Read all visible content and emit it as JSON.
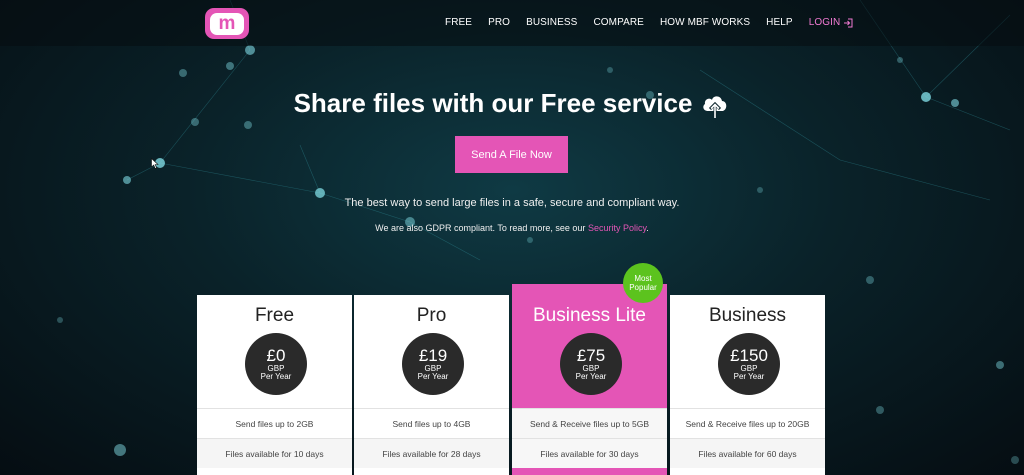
{
  "nav": {
    "items": [
      "FREE",
      "PRO",
      "BUSINESS",
      "COMPARE",
      "HOW MBF WORKS",
      "HELP"
    ],
    "login": "LOGIN"
  },
  "logo": {
    "letter": "m"
  },
  "hero": {
    "title": "Share files with our Free service",
    "cta": "Send A File Now",
    "tagline": "The best way to send large files in a safe, secure and compliant way.",
    "gdpr_prefix": "We are also GDPR compliant. To read more, see our ",
    "gdpr_link": "Security Policy",
    "gdpr_suffix": "."
  },
  "badge": {
    "line1": "Most",
    "line2": "Popular"
  },
  "plans": [
    {
      "name": "Free",
      "amount": "£0",
      "currency": "GBP",
      "period": "Per Year",
      "features": [
        "Send files up to 2GB",
        "Files available for 10 days"
      ]
    },
    {
      "name": "Pro",
      "amount": "£19",
      "currency": "GBP",
      "period": "Per Year",
      "features": [
        "Send files up to 4GB",
        "Files available for 28 days"
      ]
    },
    {
      "name": "Business Lite",
      "amount": "£75",
      "currency": "GBP",
      "period": "Per Year",
      "features": [
        "Send & Receive files up to 5GB",
        "Files available for 30 days"
      ]
    },
    {
      "name": "Business",
      "amount": "£150",
      "currency": "GBP",
      "period": "Per Year",
      "features": [
        "Send & Receive files up to 20GB",
        "Files available for 60 days"
      ]
    }
  ],
  "colors": {
    "accent": "#e455b6",
    "badge": "#5cc31e",
    "background": "#07141a"
  },
  "icons": [
    "cloud-upload-icon",
    "login-icon"
  ]
}
